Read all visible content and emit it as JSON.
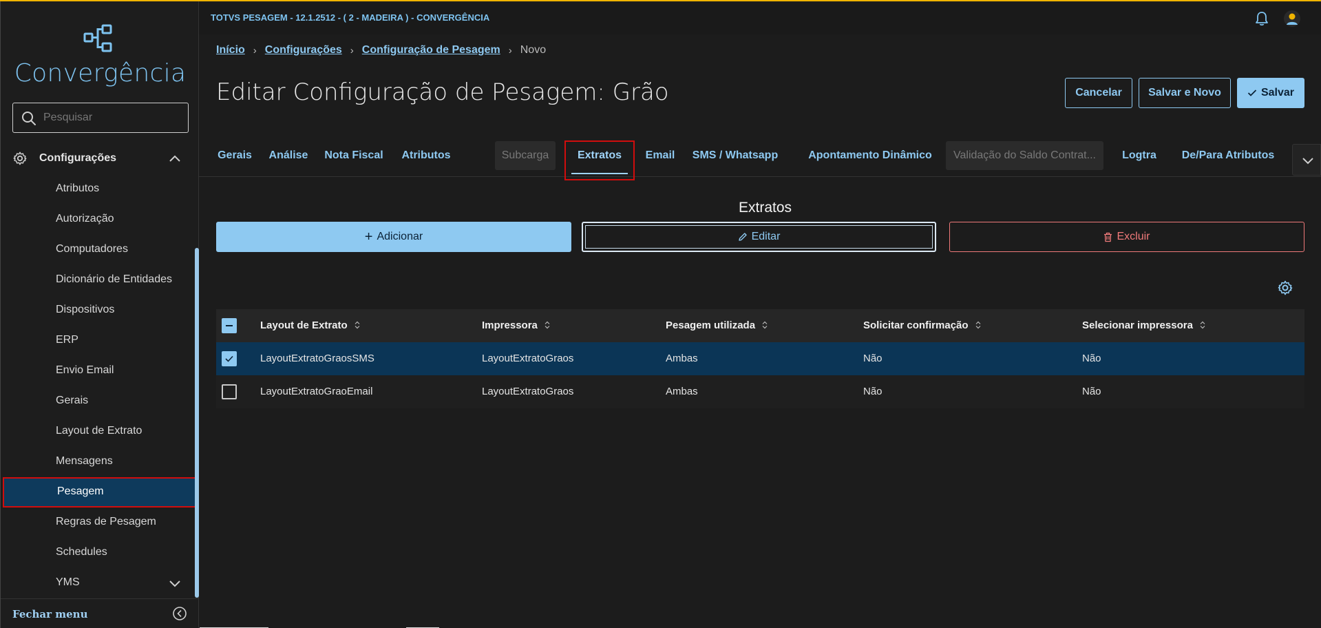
{
  "app": {
    "title": "TOTVS PESAGEM - 12.1.2512 - ( 2 - MADEIRA ) - CONVERGÊNCIA",
    "brand": "Convergência",
    "accent": "#8ec9f1",
    "top_border": "#f0b400"
  },
  "sidebar": {
    "search_placeholder": "Pesquisar",
    "group_label": "Configurações",
    "items": [
      {
        "label": "Atributos"
      },
      {
        "label": "Autorização"
      },
      {
        "label": "Computadores"
      },
      {
        "label": "Dicionário de Entidades"
      },
      {
        "label": "Dispositivos"
      },
      {
        "label": "ERP"
      },
      {
        "label": "Envio Email"
      },
      {
        "label": "Gerais"
      },
      {
        "label": "Layout de Extrato"
      },
      {
        "label": "Mensagens"
      },
      {
        "label": "Pesagem",
        "active": true
      },
      {
        "label": "Regras de Pesagem"
      },
      {
        "label": "Schedules"
      },
      {
        "label": "YMS"
      }
    ],
    "footer_label": "Fechar menu"
  },
  "breadcrumb": {
    "items": [
      "Início",
      "Configurações",
      "Configuração de Pesagem"
    ],
    "current": "Novo"
  },
  "page": {
    "title": "Editar Configuração de Pesagem: Grão",
    "buttons": {
      "cancel": "Cancelar",
      "save_new": "Salvar e Novo",
      "save": "Salvar"
    }
  },
  "tabs": [
    {
      "label": "Gerais"
    },
    {
      "label": "Análise"
    },
    {
      "label": "Nota Fiscal"
    },
    {
      "label": "Atributos"
    },
    {
      "label": "Subcarga",
      "disabled": true
    },
    {
      "label": "Extratos",
      "active": true
    },
    {
      "label": "Email"
    },
    {
      "label": "SMS / Whatsapp"
    },
    {
      "label": "Apontamento Dinâmico"
    },
    {
      "label": "Validação do Saldo Contrat...",
      "disabled": true
    },
    {
      "label": "Logtra"
    },
    {
      "label": "De/Para Atributos"
    }
  ],
  "section": {
    "title": "Extratos",
    "add": "Adicionar",
    "edit": "Editar",
    "delete": "Excluir"
  },
  "table": {
    "columns": [
      "Layout de Extrato",
      "Impressora",
      "Pesagem utilizada",
      "Solicitar confirmação",
      "Selecionar impressora"
    ],
    "rows": [
      {
        "selected": true,
        "cells": [
          "LayoutExtratoGraosSMS",
          "LayoutExtratoGraos",
          "Ambas",
          "Não",
          "Não"
        ]
      },
      {
        "selected": false,
        "cells": [
          "LayoutExtratoGraoEmail",
          "LayoutExtratoGraos",
          "Ambas",
          "Não",
          "Não"
        ]
      }
    ]
  }
}
